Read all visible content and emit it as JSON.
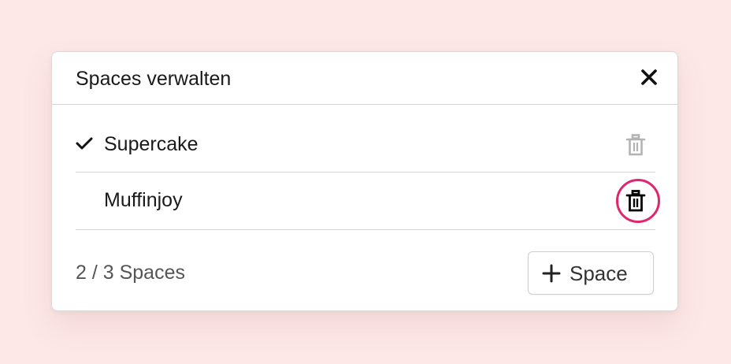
{
  "dialog": {
    "title": "Spaces verwalten",
    "close_icon": "close-icon"
  },
  "spaces": [
    {
      "name": "Supercake",
      "selected": true,
      "check_icon": "checkmark-icon",
      "delete_icon": "trash-icon",
      "delete_enabled": false
    },
    {
      "name": "Muffinjoy",
      "selected": false,
      "delete_icon": "trash-icon",
      "delete_enabled": true,
      "highlighted": true
    }
  ],
  "footer": {
    "count_text": "2 / 3 Spaces",
    "add_button_label": "Space",
    "add_button_icon": "plus-icon"
  },
  "colors": {
    "background": "#fde8e7",
    "highlight": "#e0266f",
    "disabled_icon": "#b3b3b3",
    "text": "#1a1a1a"
  }
}
